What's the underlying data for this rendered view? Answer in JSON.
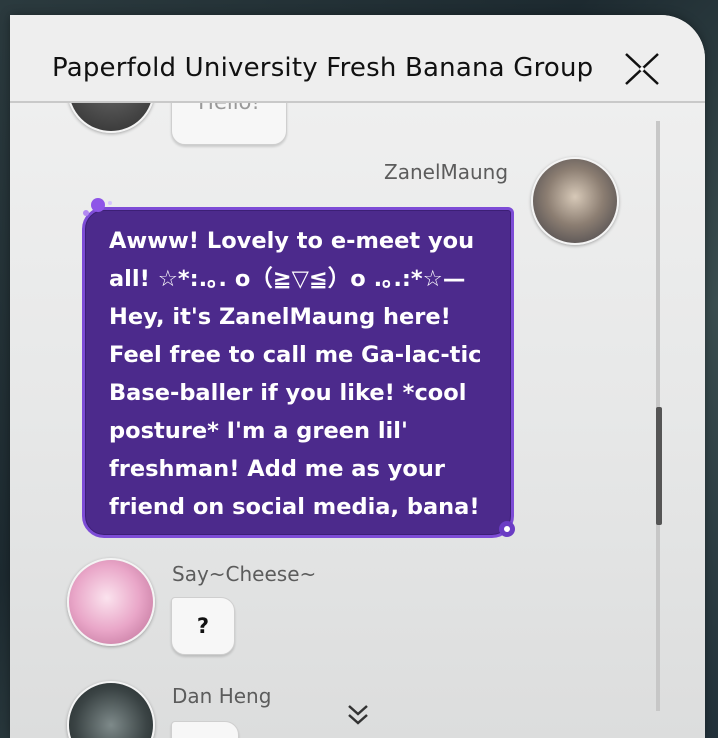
{
  "window": {
    "title": "Paperfold University Fresh Banana Group"
  },
  "messages": [
    {
      "sender": "",
      "text": "Hello!"
    },
    {
      "sender": "ZanelMaung",
      "text": "Awww! Lovely to e-meet you all! ☆*:.｡. o（≧▽≦）o .｡.:*☆—Hey, it's ZanelMaung here! Feel free to call me Ga-lac-tic Base-baller if you like! *cool posture* I'm a green lil' freshman! Add me as your friend on social media, bana!"
    },
    {
      "sender": "Say~Cheese~",
      "text": "?"
    },
    {
      "sender": "Dan Heng",
      "text": ""
    }
  ],
  "icons": {
    "close": "close-x-icon",
    "scroll_down": "double-chevron-down-icon"
  },
  "colors": {
    "accent_bubble": "#4c2a8c",
    "bubble_border": "#7d4cd6"
  }
}
